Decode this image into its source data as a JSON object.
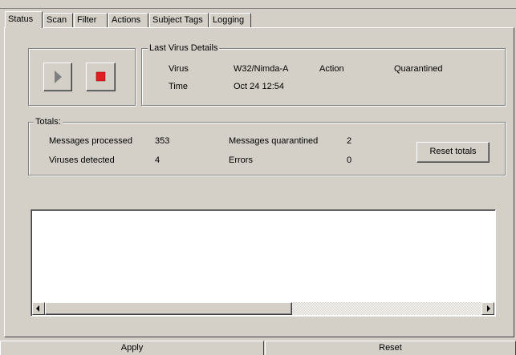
{
  "tabs": [
    {
      "label": "Status",
      "active": true
    },
    {
      "label": "Scan"
    },
    {
      "label": "Filter"
    },
    {
      "label": "Actions"
    },
    {
      "label": "Subject Tags"
    },
    {
      "label": "Logging"
    }
  ],
  "controls": {
    "play_icon": "play-icon",
    "stop_icon": "stop-icon",
    "stop_color": "#e02020"
  },
  "last_virus": {
    "legend": "Last Virus Details",
    "virus_label": "Virus",
    "virus_value": "W32/Nimda-A",
    "action_label": "Action",
    "action_value": "Quarantined",
    "time_label": "Time",
    "time_value": "Oct 24 12:54"
  },
  "totals": {
    "legend": "Totals:",
    "messages_processed_label": "Messages processed",
    "messages_processed_value": "353",
    "viruses_detected_label": "Viruses detected",
    "viruses_detected_value": "4",
    "messages_quarantined_label": "Messages quarantined",
    "messages_quarantined_value": "2",
    "errors_label": "Errors",
    "errors_value": "0",
    "reset_totals_label": "Reset totals"
  },
  "footer": {
    "apply_label": "Apply",
    "reset_label": "Reset"
  }
}
